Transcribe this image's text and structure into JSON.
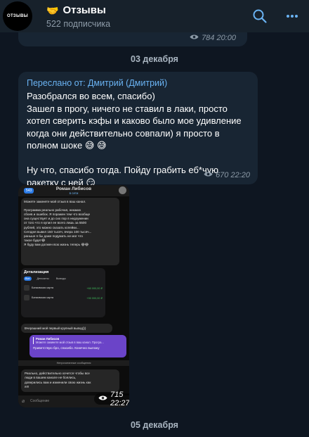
{
  "channel": {
    "avatar_text": "ОТЗЫВЫ",
    "title_emoji": "🤝",
    "title": "Отзывы",
    "subscribers": "522 подписчика"
  },
  "icons": {
    "search": "search-icon",
    "more": "more-vertical-icon",
    "views": "eye-icon",
    "share": "share-icon"
  },
  "colors": {
    "background": "#0e1621",
    "bubble": "#182533",
    "accent": "#6ab3f3",
    "muted": "#8d9ba8"
  },
  "feed": {
    "prev_message_meta": "784 20:00",
    "date_1": "03 декабря",
    "message": {
      "forward_label": "Переслано от: Дмитрий (Дмитрий)",
      "lines": [
        "Разобрался во всем, спасибо)",
        "Зашел в прогу, ничего не ставил в лаки, просто",
        "хотел сверить кэфы и каково было мое удивление",
        "когда они действительно совпали) я просто в",
        "полном шоке 😅 😅",
        "",
        "Ну что, спасибо тогда. Пойду грабить еб*чую",
        "ракетку с ней 😏"
      ],
      "meta": "670 22:20"
    },
    "media": {
      "screenshot": {
        "badge": "543",
        "contact_name": "Роман Либисов",
        "contact_status": "в сети",
        "msg1": [
          "Можете закинете мой отзыв в ваш канал.",
          "",
          "Программа реально рабочая, никаких",
          "сбоев и ошибок. Я поражен тем что вообще",
          "она существует и до сих пор в недоумении",
          "от того что я купил ее всего лишь за 5500",
          "рублей, это можно сказать копейки...",
          "Сегодня вывел 150 тысяч, вчера 100 тысяч...",
          "раньше я бы даже подумать не мог что",
          "такое будет😂",
          "Я буду вам должен всю жизнь теперь 😂😂"
        ],
        "details_title": "Детализация",
        "details_tabs": [
          "Все",
          "Депозиты",
          "Выводы"
        ],
        "details_rows": [
          {
            "name": "Банковская карта",
            "amount": "+60 000,00 ₽"
          },
          {
            "name": "Банковская карта",
            "amount": "+90 000,00 ₽"
          }
        ],
        "msg2": "Вчерашний мой первый крупный вывод)))",
        "quote_name": "Роман Либисов",
        "quote_text": "Можете закинете мой отзыв в ваш канал. Програ...",
        "reply": "Приветствую бро, спасибо. Конечно выложу",
        "unread": "Непрочитанные сообщения",
        "msg3": [
          "Реально, действительно хочется чтобы все",
          "люди в вашем канале не боялись,",
          "доверились вам и изменили свою жизнь как",
          "я!!!"
        ],
        "input_placeholder": "Сообщение"
      },
      "meta": "715 22:27"
    },
    "date_2": "05 декабря"
  }
}
